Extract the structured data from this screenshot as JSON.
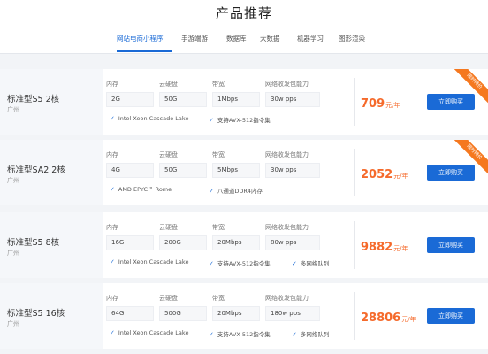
{
  "page": {
    "title": "产品推荐"
  },
  "tabs": [
    {
      "label": "网站电商小程序",
      "active": true
    },
    {
      "label": "手游端游"
    },
    {
      "label": "数据库"
    },
    {
      "label": "大数据"
    },
    {
      "label": "机器学习"
    },
    {
      "label": "图形渲染"
    }
  ],
  "spec_labels": {
    "memory": "内存",
    "disk": "云硬盘",
    "bandwidth": "带宽",
    "pps": "网络收发包能力"
  },
  "buy_label": "立即购买",
  "badge_label": "限时特价",
  "colors": {
    "accent": "#1a6ad6",
    "price": "#f56a2b",
    "badge": "#f5781f"
  },
  "products": [
    {
      "name": "标准型S5 2核",
      "region": "广州",
      "memory": "2G",
      "disk": "50G",
      "bandwidth": "1Mbps",
      "pps": "30w pps",
      "features": [
        "Intel Xeon Cascade Lake",
        "支持AVX-512指令集"
      ],
      "price": "709",
      "price_unit": "元/年",
      "badge": true
    },
    {
      "name": "标准型SA2 2核",
      "region": "广州",
      "memory": "4G",
      "disk": "50G",
      "bandwidth": "5Mbps",
      "pps": "30w pps",
      "features": [
        "AMD EPYC™ Rome",
        "八通道DDR4内存"
      ],
      "price": "2052",
      "price_unit": "元/年",
      "badge": true
    },
    {
      "name": "标准型S5 8核",
      "region": "广州",
      "memory": "16G",
      "disk": "200G",
      "bandwidth": "20Mbps",
      "pps": "80w pps",
      "features": [
        "Intel Xeon Cascade Lake",
        "支持AVX-512指令集",
        "多网络队列"
      ],
      "price": "9882",
      "price_unit": "元/年",
      "badge": false
    },
    {
      "name": "标准型S5 16核",
      "region": "广州",
      "memory": "64G",
      "disk": "500G",
      "bandwidth": "20Mbps",
      "pps": "180w pps",
      "features": [
        "Intel Xeon Cascade Lake",
        "支持AVX-512指令集",
        "多网络队列"
      ],
      "price": "28806",
      "price_unit": "元/年",
      "badge": false
    }
  ]
}
